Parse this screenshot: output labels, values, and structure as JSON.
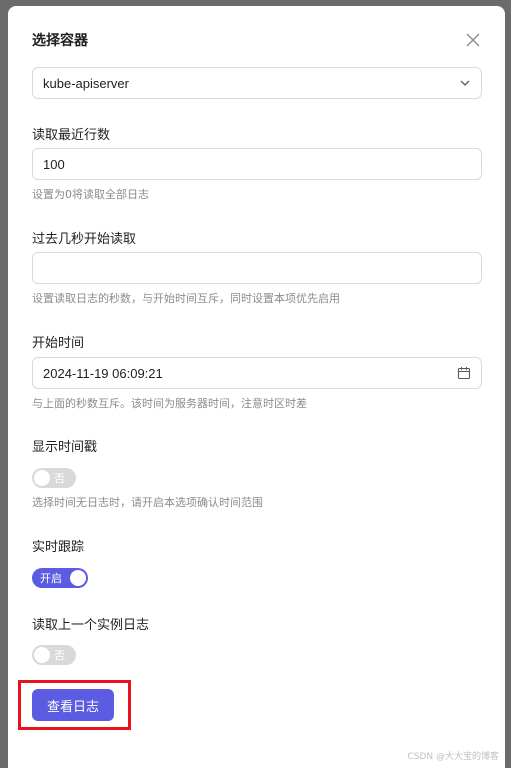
{
  "modal": {
    "title": "选择容器",
    "container_select": {
      "value": "kube-apiserver"
    },
    "tail_lines": {
      "label": "读取最近行数",
      "value": "100",
      "help": "设置为0将读取全部日志"
    },
    "since_seconds": {
      "label": "过去几秒开始读取",
      "value": "",
      "placeholder": "",
      "help": "设置读取日志的秒数，与开始时间互斥，同时设置本项优先启用"
    },
    "since_time": {
      "label": "开始时间",
      "value": "2024-11-19 06:09:21",
      "help": "与上面的秒数互斥。该时间为服务器时间，注意时区时差"
    },
    "timestamps": {
      "label": "显示时间戳",
      "switch_text": "否",
      "enabled": false,
      "help": "选择时间无日志时，请开启本选项确认时间范围"
    },
    "follow": {
      "label": "实时跟踪",
      "switch_text": "开启",
      "enabled": true
    },
    "previous": {
      "label": "读取上一个实例日志",
      "switch_text": "否",
      "enabled": false
    },
    "submit_label": "查看日志"
  },
  "watermark": "CSDN @大大宝的博客",
  "colors": {
    "primary": "#5b5ce2",
    "highlight": "#e8141b",
    "switch_off": "#d9d9d9"
  }
}
